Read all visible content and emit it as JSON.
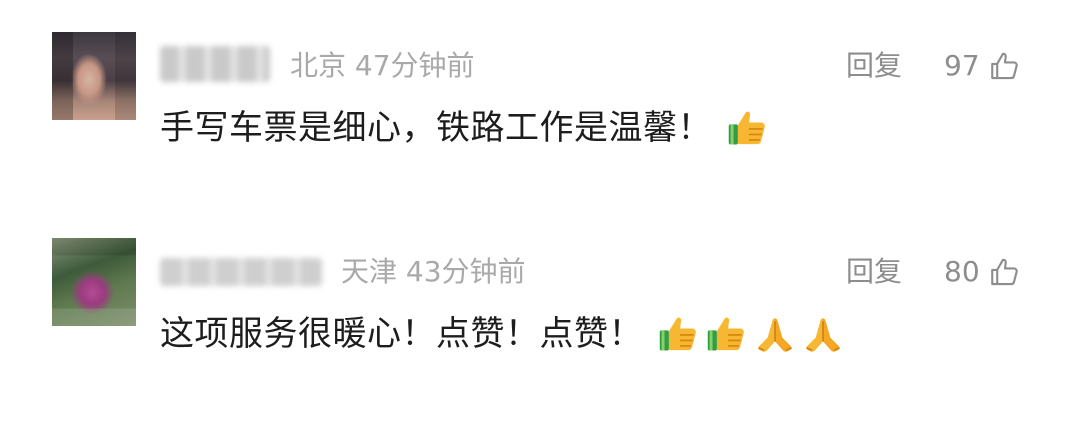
{
  "comments": [
    {
      "location": "北京",
      "time": "47分钟前",
      "reply_label": "回复",
      "likes": "97",
      "text": "手写车票是细心，铁路工作是温馨！",
      "emojis": [
        "thumbs-up"
      ]
    },
    {
      "location": "天津",
      "time": "43分钟前",
      "reply_label": "回复",
      "likes": "80",
      "text": "这项服务很暖心！点赞！点赞！",
      "emojis": [
        "thumbs-up",
        "thumbs-up",
        "folded-hands",
        "folded-hands"
      ]
    }
  ],
  "colors": {
    "meta_text": "#a9a9a9",
    "action_text": "#8d8d8d",
    "body_text": "#1d1d1d"
  }
}
